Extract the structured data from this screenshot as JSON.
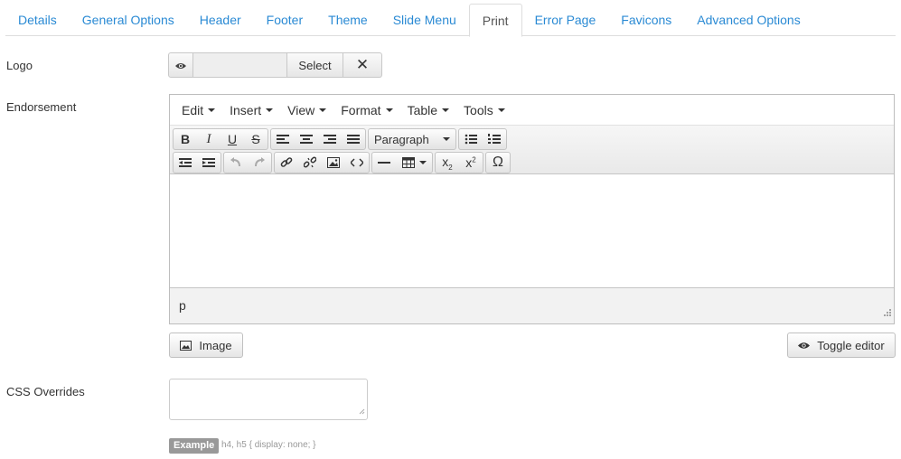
{
  "tabs": [
    {
      "label": "Details"
    },
    {
      "label": "General Options"
    },
    {
      "label": "Header"
    },
    {
      "label": "Footer"
    },
    {
      "label": "Theme"
    },
    {
      "label": "Slide Menu"
    },
    {
      "label": "Print",
      "active": true
    },
    {
      "label": "Error Page"
    },
    {
      "label": "Favicons"
    },
    {
      "label": "Advanced Options"
    }
  ],
  "logo": {
    "label": "Logo",
    "select_label": "Select",
    "clear_symbol": "✕"
  },
  "endorsement": {
    "label": "Endorsement",
    "menus": [
      "Edit",
      "Insert",
      "View",
      "Format",
      "Table",
      "Tools"
    ],
    "format_select": "Paragraph",
    "status_path": "p",
    "image_button": "Image",
    "toggle_button": "Toggle editor"
  },
  "css_overrides": {
    "label": "CSS Overrides",
    "example_badge": "Example",
    "example_text": "h4, h5 { display: none; }"
  },
  "colors": {
    "tab_link": "#2a8ad4",
    "badge_bg": "#999999"
  }
}
